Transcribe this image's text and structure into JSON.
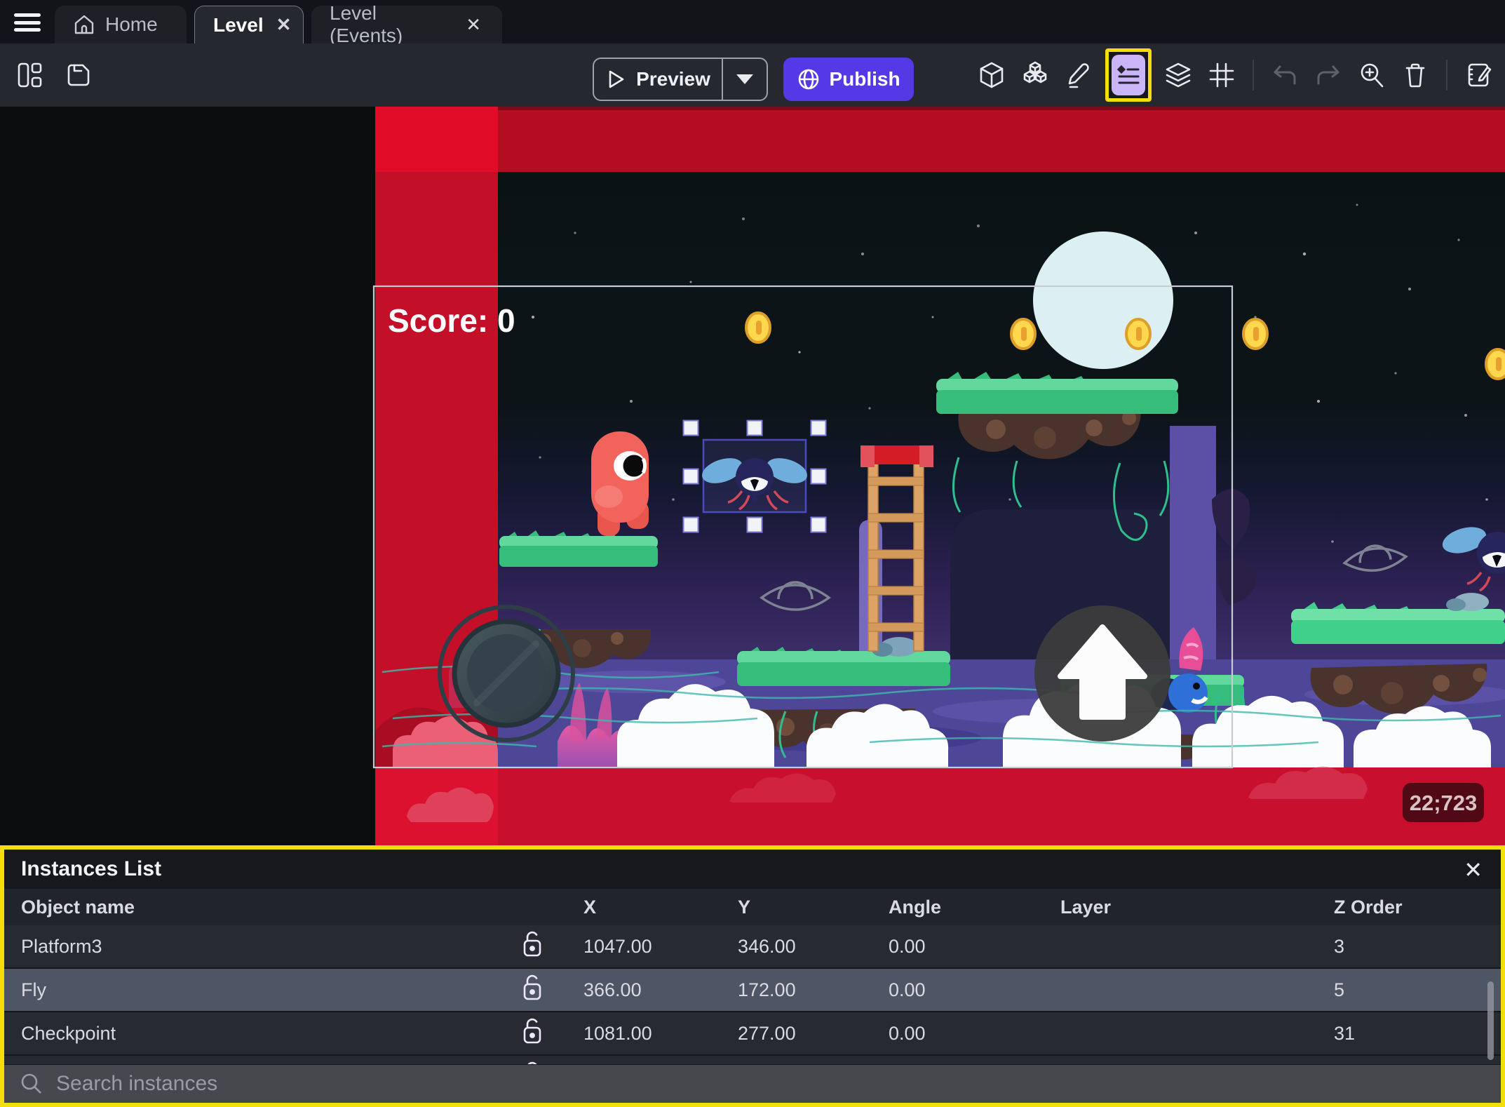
{
  "tabs": [
    {
      "label": "Home",
      "icon": "home-icon",
      "closable": false,
      "active": false
    },
    {
      "label": "Level",
      "closable": true,
      "active": true,
      "close_glyph": "✕"
    },
    {
      "label": "Level (Events)",
      "closable": true,
      "active": false,
      "close_glyph": "✕"
    }
  ],
  "toolbar": {
    "left_icons": [
      "panels-layout-icon",
      "save-icon"
    ],
    "preview_label": "Preview",
    "publish_label": "Publish",
    "right_icons": [
      "cube-icon",
      "objects-group-icon",
      "pencil-icon",
      "instances-list-icon",
      "layers-icon",
      "grid-icon",
      "undo-icon",
      "redo-icon",
      "zoom-in-icon",
      "trash-icon",
      "edit-note-icon"
    ],
    "highlighted_icon": "instances-list-icon"
  },
  "scene": {
    "score_text": "Score: 0",
    "coordinates_badge": "22;723",
    "selected_instance": "Fly",
    "colors": {
      "out_of_bounds_red": "#C30F28",
      "sky_dark": "#0A1313",
      "dusk_purple": "#3A2C66",
      "water_purple": "#4E4798",
      "grass_green": "#36BD7C",
      "selection_stroke": "#4B4BC0",
      "highlight_yellow": "#F2DE0A",
      "accent_purple": "#5639E6"
    }
  },
  "panel": {
    "title": "Instances List",
    "close_glyph": "✕",
    "columns": [
      "Object name",
      "X",
      "Y",
      "Angle",
      "Layer",
      "Z Order"
    ],
    "rows": [
      {
        "name": "Platform3",
        "x": "1047.00",
        "y": "346.00",
        "angle": "0.00",
        "layer": "",
        "z": "3",
        "locked": false
      },
      {
        "name": "Fly",
        "x": "366.00",
        "y": "172.00",
        "angle": "0.00",
        "layer": "",
        "z": "5",
        "locked": false,
        "selected": true
      },
      {
        "name": "Checkpoint",
        "x": "1081.00",
        "y": "277.00",
        "angle": "0.00",
        "layer": "",
        "z": "31",
        "locked": false
      }
    ],
    "search_placeholder": "Search instances"
  }
}
